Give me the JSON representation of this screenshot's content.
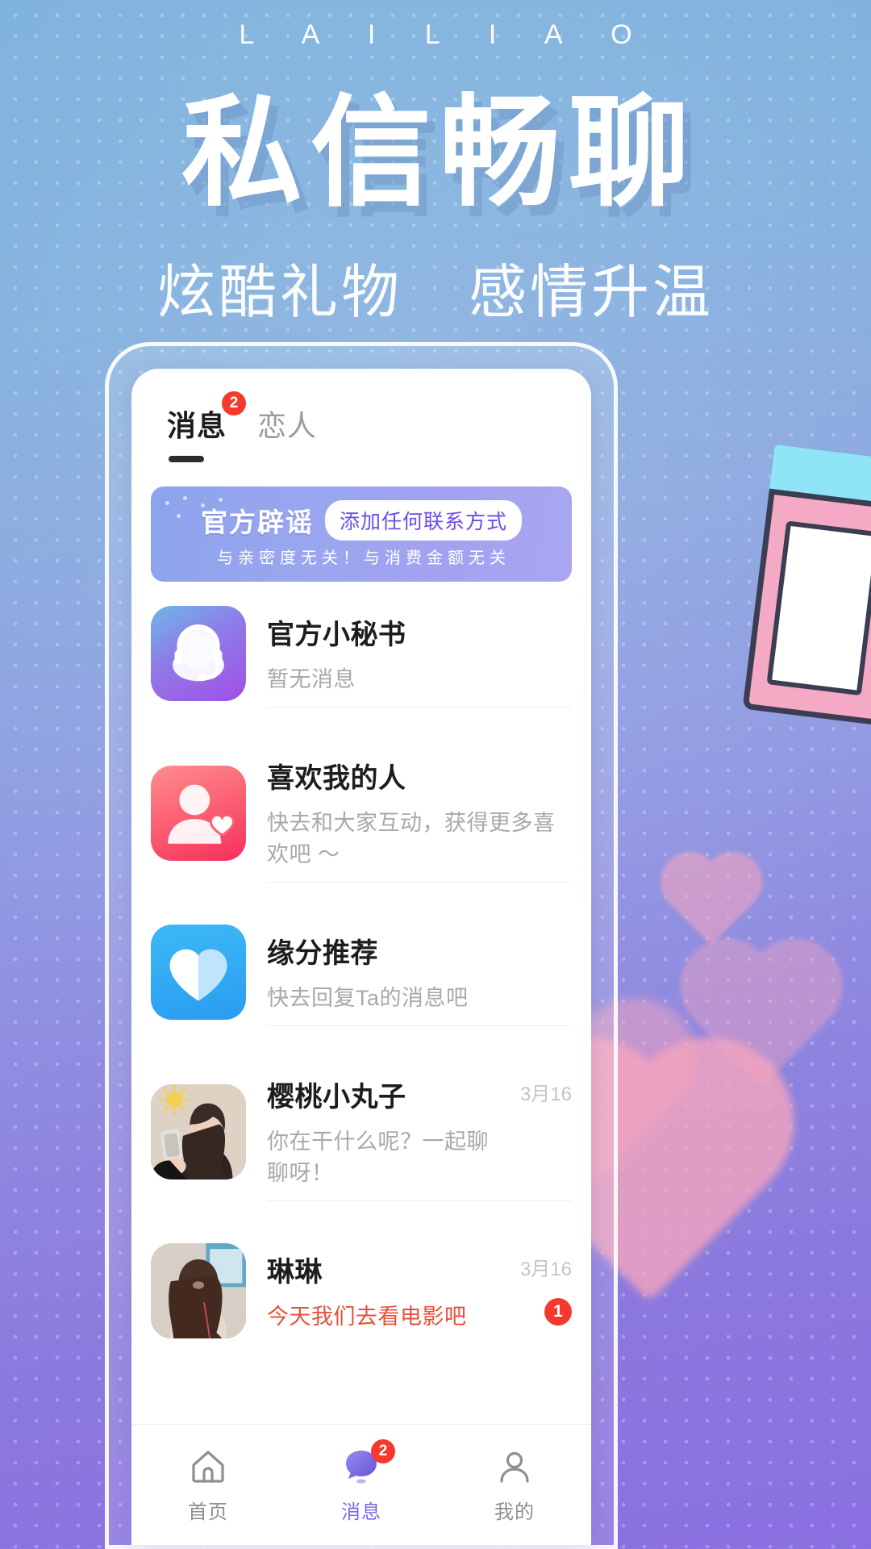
{
  "header": {
    "brand": "L A I L I A O",
    "headline": "私信畅聊",
    "subheadline_left": "炫酷礼物",
    "subheadline_right": "感情升温"
  },
  "app": {
    "tabs": [
      {
        "label": "消息",
        "badge": "2",
        "active": true
      },
      {
        "label": "恋人",
        "badge": "",
        "active": false
      }
    ],
    "promo": {
      "title": "官方辟谣",
      "pill": "添加任何联系方式",
      "subtitle": "与亲密度无关！与消费金额无关"
    },
    "conversations": [
      {
        "name": "官方小秘书",
        "preview": "暂无消息",
        "time": "",
        "unread": "",
        "avatar": "secretary-avatar",
        "highlight": false
      },
      {
        "name": "喜欢我的人",
        "preview": "快去和大家互动，获得更多喜欢吧 ～",
        "time": "",
        "unread": "",
        "avatar": "likes-avatar",
        "highlight": false
      },
      {
        "name": "缘分推荐",
        "preview": "快去回复Ta的消息吧",
        "time": "",
        "unread": "",
        "avatar": "match-avatar",
        "highlight": false
      },
      {
        "name": "樱桃小丸子",
        "preview": "你在干什么呢？一起聊聊呀！",
        "time": "3月16",
        "unread": "",
        "avatar": "photo-avatar-1",
        "highlight": false
      },
      {
        "name": "琳琳",
        "preview": "今天我们去看电影吧",
        "time": "3月16",
        "unread": "1",
        "avatar": "photo-avatar-2",
        "highlight": true
      }
    ],
    "nav": [
      {
        "label": "首页",
        "icon": "home-icon",
        "badge": "",
        "active": false
      },
      {
        "label": "消息",
        "icon": "message-icon",
        "badge": "2",
        "active": true
      },
      {
        "label": "我的",
        "icon": "profile-icon",
        "badge": "",
        "active": false
      }
    ]
  },
  "colors": {
    "accent": "#7a6ae8",
    "badge": "#f5392e",
    "unread_text": "#e8503a",
    "promo_pill_text": "#6a4df0"
  }
}
